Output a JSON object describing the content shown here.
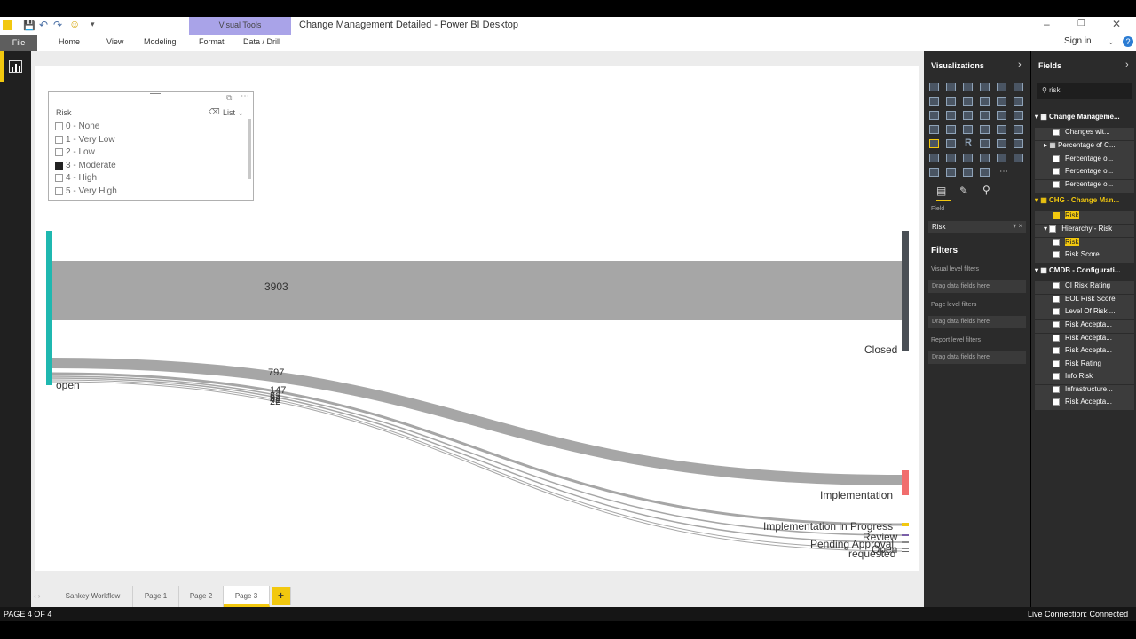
{
  "app": {
    "title": "Change Management Detailed - Power BI Desktop",
    "visual_tools_tab": "Visual Tools",
    "sign_in": "Sign in"
  },
  "ribbon": {
    "file": "File",
    "tabs": [
      "Home",
      "View",
      "Modeling",
      "Format",
      "Data / Drill"
    ]
  },
  "slicer": {
    "title": "Risk",
    "mode": "List",
    "items": [
      {
        "label": "0 - None",
        "checked": false
      },
      {
        "label": "1 - Very Low",
        "checked": false
      },
      {
        "label": "2 - Low",
        "checked": false
      },
      {
        "label": "3 - Moderate",
        "checked": true
      },
      {
        "label": "4 - High",
        "checked": false
      },
      {
        "label": "5 - Very High",
        "checked": false
      }
    ]
  },
  "sankey": {
    "source": "open",
    "flows": [
      {
        "target": "Closed",
        "value": "3903"
      },
      {
        "target": "Implementation",
        "value": "797"
      },
      {
        "target": "Implementation in Progress",
        "value": "147"
      },
      {
        "target": "Review",
        "value": "63"
      },
      {
        "target": "Pending Approval",
        "value": "52"
      },
      {
        "target": "Open",
        "value": "42"
      },
      {
        "target": "requested",
        "value": "22"
      }
    ],
    "colors": {
      "open": "#1fb8b0",
      "closed": "#4a4f55",
      "implementation": "#f16d6d",
      "in_progress": "#f2c80f",
      "review": "#7a5fa8",
      "flow": "#a6a6a6"
    }
  },
  "page_tabs": {
    "tabs": [
      "Sankey Workflow",
      "Page 1",
      "Page 2",
      "Page 3"
    ],
    "active": "Page 3",
    "add": "+"
  },
  "status": {
    "page": "PAGE 4 OF 4",
    "connection": "Live Connection: Connected"
  },
  "visualizations": {
    "title": "Visualizations",
    "field_label": "Field",
    "field_value": "Risk"
  },
  "filters": {
    "title": "Filters",
    "visual_level": "Visual level filters",
    "page_level": "Page level filters",
    "report_level": "Report level filters",
    "drop_hint": "Drag data fields here"
  },
  "fields": {
    "title": "Fields",
    "search": "risk",
    "rows": [
      {
        "text": "Change Manageme...",
        "type": "table"
      },
      {
        "text": "Changes wit...",
        "type": "field"
      },
      {
        "text": "Percentage of C...",
        "type": "group"
      },
      {
        "text": "Percentage o...",
        "type": "field"
      },
      {
        "text": "Percentage o...",
        "type": "field"
      },
      {
        "text": "Percentage o...",
        "type": "field"
      },
      {
        "text": "CHG - Change Man...",
        "type": "table"
      },
      {
        "text": "Risk",
        "type": "field"
      },
      {
        "text": "Hierarchy - Risk",
        "type": "group"
      },
      {
        "text": "Risk",
        "type": "field"
      },
      {
        "text": "Risk Score",
        "type": "field"
      },
      {
        "text": "CMDB - Configurati...",
        "type": "table"
      },
      {
        "text": "CI Risk Rating",
        "type": "field"
      },
      {
        "text": "EOL Risk Score",
        "type": "field"
      },
      {
        "text": "Level Of Risk ...",
        "type": "field"
      },
      {
        "text": "Risk Accepta...",
        "type": "field"
      },
      {
        "text": "Risk Accepta...",
        "type": "field"
      },
      {
        "text": "Risk Accepta...",
        "type": "field"
      },
      {
        "text": "Risk Rating",
        "type": "field"
      },
      {
        "text": "Info Risk",
        "type": "field"
      },
      {
        "text": "Infrastructure...",
        "type": "field"
      },
      {
        "text": "Risk Accepta...",
        "type": "field"
      }
    ]
  }
}
